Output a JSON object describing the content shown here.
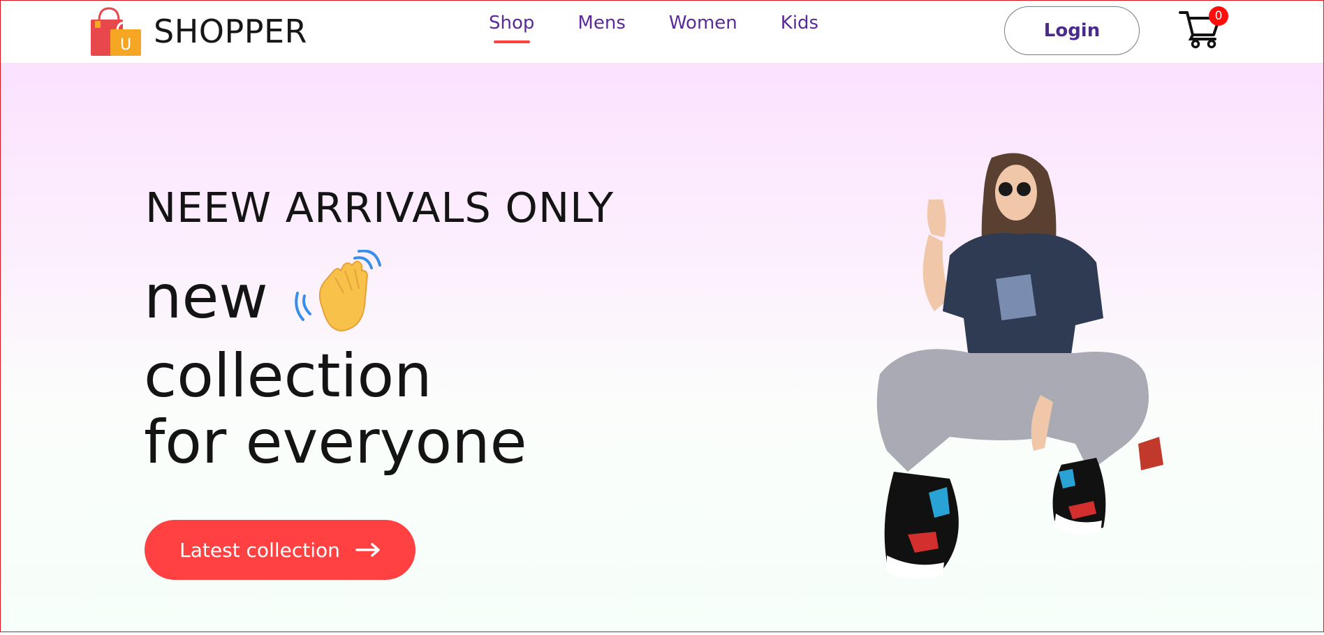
{
  "brand": {
    "name": "SHOPPER",
    "logo_letter": "U"
  },
  "nav": {
    "items": [
      {
        "label": "Shop",
        "active": true
      },
      {
        "label": "Mens",
        "active": false
      },
      {
        "label": "Women",
        "active": false
      },
      {
        "label": "Kids",
        "active": false
      }
    ]
  },
  "header": {
    "login_label": "Login",
    "cart_count": "0"
  },
  "hero": {
    "tagline": "NEEW ARRIVALS ONLY",
    "line1": "new",
    "line2": "collection",
    "line3": "for everyone",
    "cta_label": "Latest collection"
  },
  "colors": {
    "accent": "#ff4141",
    "nav_text": "#5a2a9a",
    "hero_top": "#fbe2ff",
    "hero_bottom": "#f6fff9"
  },
  "icons": [
    "shopping-bag-logo-icon",
    "cart-icon",
    "waving-hand-icon",
    "arrow-right-icon"
  ]
}
